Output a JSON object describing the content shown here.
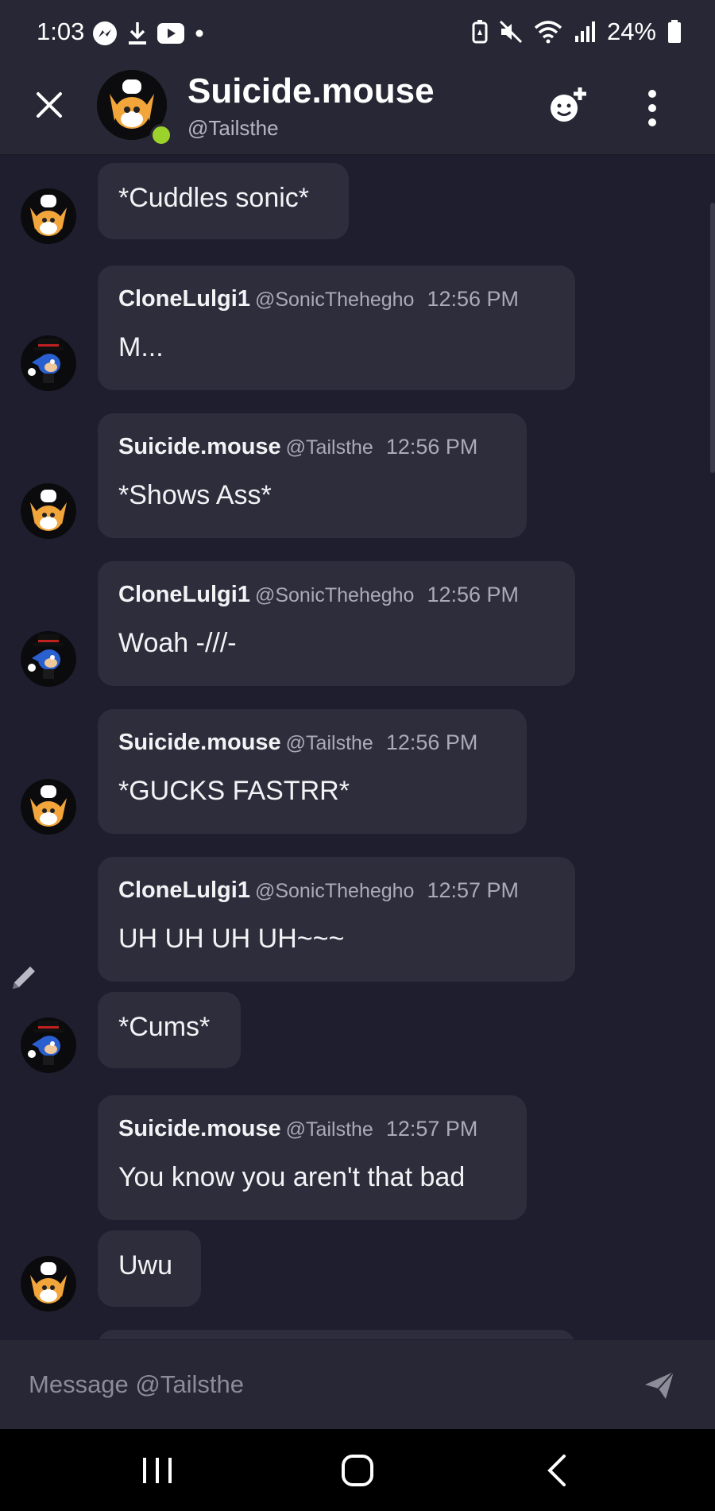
{
  "status_bar": {
    "time": "1:03",
    "battery": "24%",
    "left_icons": [
      "messenger-icon",
      "download-icon",
      "youtube-icon",
      "dot-icon"
    ],
    "right_icons": [
      "battery-saver-icon",
      "mute-icon",
      "wifi-icon",
      "signal-icon",
      "battery-icon"
    ]
  },
  "header": {
    "title": "Suicide.mouse",
    "subtitle": "@Tailsthe",
    "status_color": "#9bd32c"
  },
  "messages": [
    {
      "author": "",
      "handle": "",
      "time": "",
      "text": "*Cuddles sonic*",
      "avatar": "tails-avatar"
    },
    {
      "author": "CloneLulgi1",
      "handle": "@SonicThehegho",
      "time": "12:56 PM",
      "text": "M...",
      "avatar": "sonic-avatar"
    },
    {
      "author": "Suicide.mouse",
      "handle": "@Tailsthe",
      "time": "12:56 PM",
      "text": "*Shows Ass*",
      "avatar": "tails-avatar"
    },
    {
      "author": "CloneLulgi1",
      "handle": "@SonicThehegho",
      "time": "12:56 PM",
      "text": "Woah -///-",
      "avatar": "sonic-avatar"
    },
    {
      "author": "Suicide.mouse",
      "handle": "@Tailsthe",
      "time": "12:56 PM",
      "text": "*GUCKS FASTRR*",
      "avatar": "tails-avatar"
    },
    {
      "author": "CloneLulgi1",
      "handle": "@SonicThehegho",
      "time": "12:57 PM",
      "text": "UH UH UH UH~~~",
      "avatar": ""
    },
    {
      "author": "",
      "handle": "",
      "time": "",
      "text": "*Cums*",
      "avatar": "sonic-avatar"
    },
    {
      "author": "Suicide.mouse",
      "handle": "@Tailsthe",
      "time": "12:57 PM",
      "text": "You know you aren't that bad",
      "avatar": ""
    },
    {
      "author": "",
      "handle": "",
      "time": "",
      "text": "Uwu",
      "avatar": "tails-avatar"
    }
  ],
  "composer": {
    "placeholder": "Message @Tailsthe"
  },
  "nav": [
    "recents-icon",
    "home-icon",
    "back-icon"
  ],
  "colors": {
    "background": "#1f1e2e",
    "bubble": "#2e2d3c",
    "header": "#272735"
  }
}
